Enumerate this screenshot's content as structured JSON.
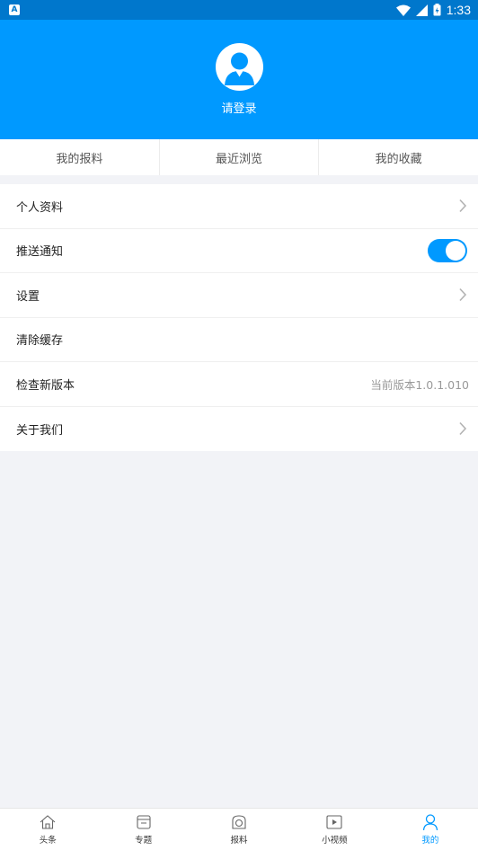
{
  "status_bar": {
    "app_icon": "A",
    "time": "1:33"
  },
  "profile": {
    "login_text": "请登录"
  },
  "quick_tabs": [
    {
      "label": "我的报料"
    },
    {
      "label": "最近浏览"
    },
    {
      "label": "我的收藏"
    }
  ],
  "menu": [
    {
      "label": "个人资料"
    },
    {
      "label": "推送通知",
      "toggle_on": true
    },
    {
      "label": "设置"
    },
    {
      "label": "清除缓存"
    },
    {
      "label": "检查新版本",
      "value": "当前版本1.0.1.010"
    },
    {
      "label": "关于我们"
    }
  ],
  "tab_bar": [
    {
      "label": "头条",
      "icon": "home-icon"
    },
    {
      "label": "专题",
      "icon": "topic-icon"
    },
    {
      "label": "报料",
      "icon": "report-icon"
    },
    {
      "label": "小视频",
      "icon": "video-icon"
    },
    {
      "label": "我的",
      "icon": "user-icon",
      "active": true
    }
  ],
  "colors": {
    "brand": "#0099ff",
    "status_bar": "#0077cc"
  }
}
